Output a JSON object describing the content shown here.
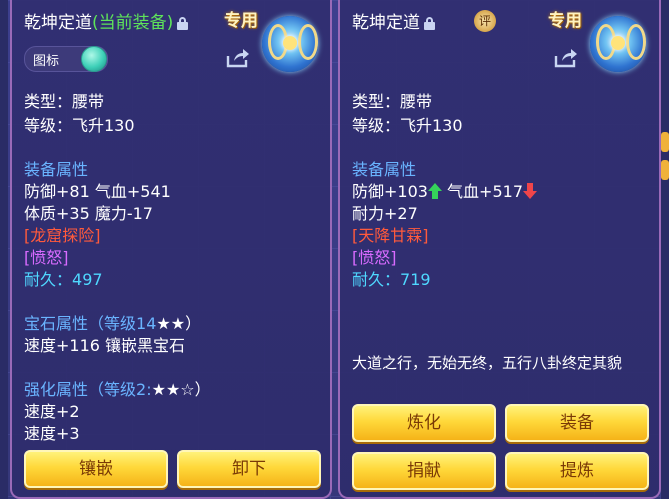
{
  "left": {
    "name": "乾坤定道",
    "status": "(当前装备)",
    "tag": "专用",
    "icon_toggle_label": "图标",
    "type_line": "类型：腰带",
    "level_line": "等级：飞升130",
    "attr_heading": "装备属性",
    "attr1": "防御+81 气血+541",
    "attr2": "体质+35 魔力-17",
    "special1": "[龙窟探险]",
    "special2": "[愤怒]",
    "durability_label": "耐久：",
    "durability_value": "497",
    "gem_heading": "宝石属性",
    "gem_level": "（等级14",
    "gem_stars": "★★）",
    "gem_line": "速度+116 镶嵌黑宝石",
    "enhance_heading": "强化属性",
    "enhance_level": "（等级2:",
    "enhance_stars": "★★☆）",
    "enhance1": "速度+2",
    "enhance2": "速度+3",
    "btn_inlay": "镶嵌",
    "btn_remove": "卸下"
  },
  "right": {
    "name": "乾坤定道",
    "tag": "专用",
    "badge": "评",
    "type_line": "类型：腰带",
    "level_line": "等级：飞升130",
    "attr_heading": "装备属性",
    "attr1a": "防御+103",
    "attr1b": "气血+517",
    "attr2": "耐力+27",
    "special1": "[天降甘霖]",
    "special2": "[愤怒]",
    "durability_label": "耐久：",
    "durability_value": "719",
    "description": "大道之行，无始无终，五行八卦终定其貌",
    "btn_refine": "炼化",
    "btn_equip": "装备",
    "btn_donate": "捐献",
    "btn_extract": "提炼"
  },
  "colors": {
    "up_arrow": "#35d35a",
    "down_arrow": "#f0454a"
  }
}
